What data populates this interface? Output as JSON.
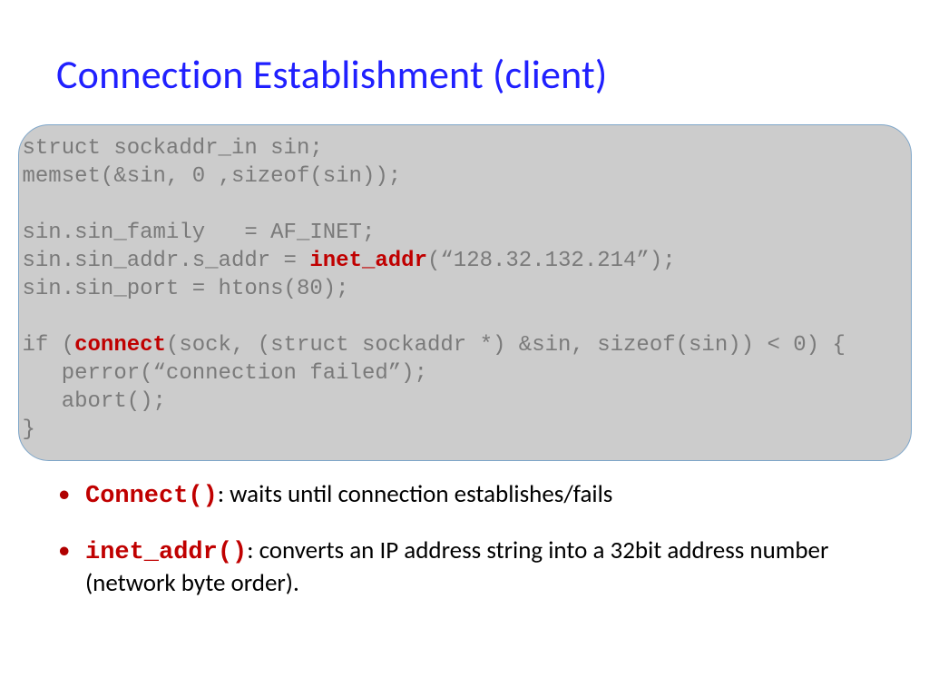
{
  "title": "Connection Establishment (client)",
  "code": {
    "l1": "struct sockaddr_in sin;",
    "l2": "memset(&sin, 0 ,sizeof(sin));",
    "l3": "",
    "l4": "sin.sin_family   = AF_INET;",
    "l5a": "sin.sin_addr.s_addr = ",
    "l5b": "inet_addr",
    "l5c": "(“128.32.132.214”);",
    "l6": "sin.sin_port = htons(80);",
    "l7": "",
    "l8a": "if (",
    "l8b": "connect",
    "l8c": "(sock, (struct sockaddr *) &sin, sizeof(sin)) < 0) {",
    "l9": "   perror(“connection failed”);",
    "l10": "   abort();",
    "l11": "}"
  },
  "bullets": {
    "b1fn": "Connect()",
    "b1text": ": waits until connection establishes/fails",
    "b2fn": "inet_addr()",
    "b2text": ": converts an IP address string into a 32bit address number (network byte order)."
  }
}
